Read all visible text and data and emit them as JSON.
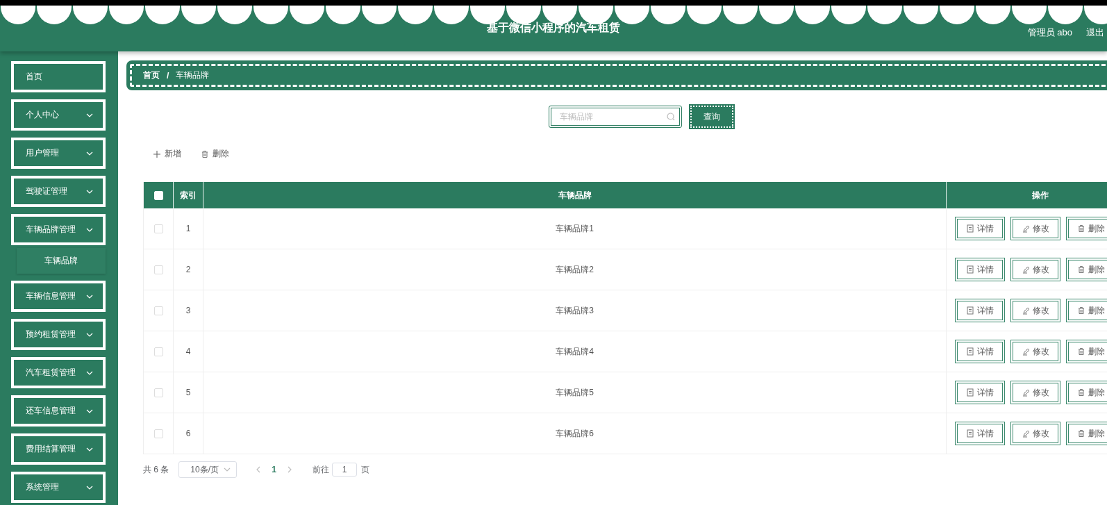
{
  "header": {
    "title": "基于微信小程序的汽车租赁",
    "user": "管理员 abo",
    "logout": "退出"
  },
  "sidebar": {
    "items": [
      {
        "label": "首页",
        "kind": "link"
      },
      {
        "label": "个人中心",
        "kind": "menu"
      },
      {
        "label": "用户管理",
        "kind": "menu"
      },
      {
        "label": "驾驶证管理",
        "kind": "menu"
      },
      {
        "label": "车辆品牌管理",
        "kind": "menu",
        "children": [
          {
            "label": "车辆品牌"
          }
        ]
      },
      {
        "label": "车辆信息管理",
        "kind": "menu"
      },
      {
        "label": "预约租赁管理",
        "kind": "menu"
      },
      {
        "label": "汽车租赁管理",
        "kind": "menu"
      },
      {
        "label": "还车信息管理",
        "kind": "menu"
      },
      {
        "label": "费用结算管理",
        "kind": "menu"
      },
      {
        "label": "系统管理",
        "kind": "menu"
      }
    ]
  },
  "breadcrumb": [
    "首页",
    "车辆品牌"
  ],
  "breadcrumb_separator": "/",
  "search": {
    "placeholder": "车辆品牌",
    "button": "查询"
  },
  "toolbar": [
    {
      "label": "新增",
      "kind": "add"
    },
    {
      "label": "删除",
      "kind": "delete"
    }
  ],
  "table": {
    "columns": [
      "索引",
      "车辆品牌",
      "操作"
    ],
    "header_checked": false,
    "rows": [
      {
        "index": "1",
        "brand": "车辆品牌1",
        "checked": false,
        "actions": [
          {
            "label": "详情",
            "kind": "detail"
          },
          {
            "label": "修改",
            "kind": "edit"
          },
          {
            "label": "删除",
            "kind": "delete"
          }
        ]
      },
      {
        "index": "2",
        "brand": "车辆品牌2",
        "checked": false,
        "actions": [
          {
            "label": "详情",
            "kind": "detail"
          },
          {
            "label": "修改",
            "kind": "edit"
          },
          {
            "label": "删除",
            "kind": "delete"
          }
        ]
      },
      {
        "index": "3",
        "brand": "车辆品牌3",
        "checked": false,
        "actions": [
          {
            "label": "详情",
            "kind": "detail"
          },
          {
            "label": "修改",
            "kind": "edit"
          },
          {
            "label": "删除",
            "kind": "delete"
          }
        ]
      },
      {
        "index": "4",
        "brand": "车辆品牌4",
        "checked": false,
        "actions": [
          {
            "label": "详情",
            "kind": "detail"
          },
          {
            "label": "修改",
            "kind": "edit"
          },
          {
            "label": "删除",
            "kind": "delete"
          }
        ]
      },
      {
        "index": "5",
        "brand": "车辆品牌5",
        "checked": false,
        "actions": [
          {
            "label": "详情",
            "kind": "detail"
          },
          {
            "label": "修改",
            "kind": "edit"
          },
          {
            "label": "删除",
            "kind": "delete"
          }
        ]
      },
      {
        "index": "6",
        "brand": "车辆品牌6",
        "checked": false,
        "actions": [
          {
            "label": "详情",
            "kind": "detail"
          },
          {
            "label": "修改",
            "kind": "edit"
          },
          {
            "label": "删除",
            "kind": "delete"
          }
        ]
      }
    ]
  },
  "pagination": {
    "total": "共 6 条",
    "page_size": "10条/页",
    "pages": [
      {
        "label": "1",
        "selected": true
      }
    ],
    "goto_label": "前往",
    "goto_value": "1",
    "page_suffix": "页"
  }
}
